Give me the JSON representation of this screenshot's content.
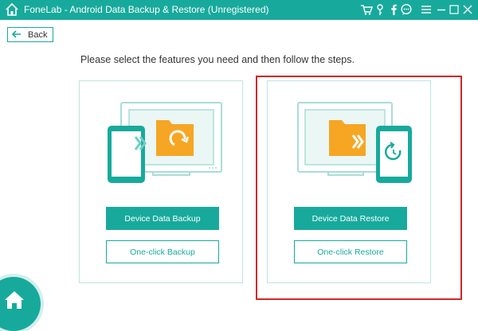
{
  "app": {
    "title": "FoneLab - Android Data Backup & Restore (Unregistered)"
  },
  "titlebar": {
    "icons": [
      "home-icon",
      "cart-icon",
      "key-icon",
      "facebook-icon",
      "chat-icon",
      "menu-icon",
      "minimize-icon",
      "close-icon"
    ]
  },
  "nav": {
    "back_label": "Back"
  },
  "main": {
    "instruction": "Please select the features you need and then follow the steps.",
    "backup": {
      "primary_label": "Device Data Backup",
      "secondary_label": "One-click Backup"
    },
    "restore": {
      "primary_label": "Device Data Restore",
      "secondary_label": "One-click Restore"
    }
  },
  "colors": {
    "accent": "#17aa9c",
    "folder": "#f6a623",
    "highlight": "#d32626",
    "card_border": "#bde6e1"
  }
}
